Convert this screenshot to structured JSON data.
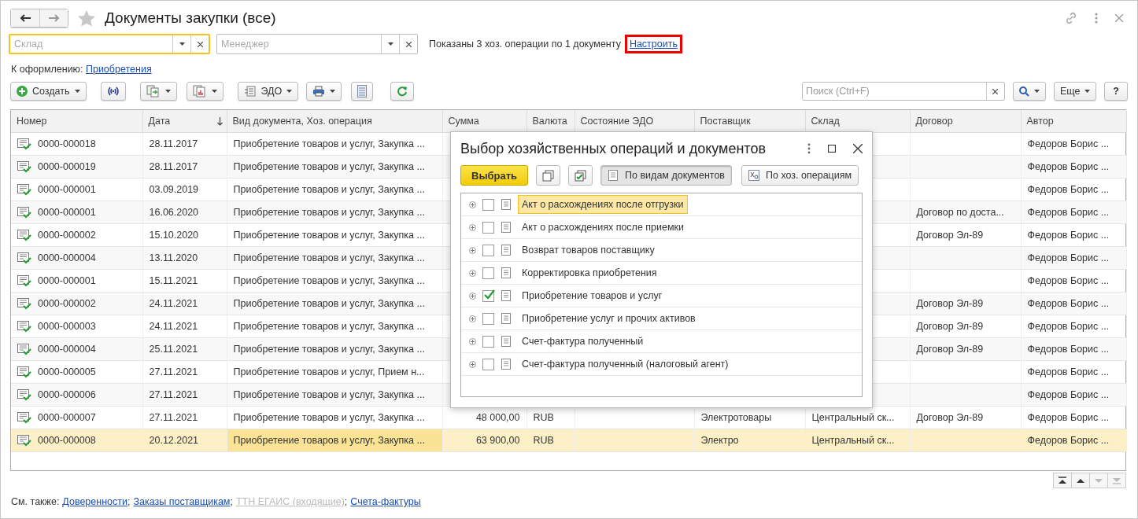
{
  "window": {
    "title": "Документы закупки (все)"
  },
  "filters": [
    {
      "placeholder": "Склад",
      "focused": true
    },
    {
      "placeholder": "Менеджер",
      "focused": false
    }
  ],
  "filter_info": "Показаны 3 хоз. операции по 1 документу",
  "configure_link": {
    "label": "Настроить",
    "highlighted": true
  },
  "to_process": {
    "label": "К оформлению:",
    "link": "Приобретения"
  },
  "toolbar": [
    {
      "label": "Создать",
      "dropdown": true
    },
    {
      "dropdown": false
    },
    {
      "dropdown": true
    },
    {
      "dropdown": true
    },
    {
      "label": "ЭДО",
      "dropdown": true
    },
    {
      "dropdown": true
    },
    {
      "dropdown": false
    },
    {
      "dropdown": false
    }
  ],
  "search": {
    "placeholder": "Поиск (Ctrl+F)"
  },
  "more_button": "Еще",
  "help_button": "?",
  "table": {
    "columns": [
      {
        "label": "Номер",
        "sorted": false
      },
      {
        "label": "Дата",
        "sorted": true
      },
      {
        "label": "Вид документа, Хоз. операция",
        "sorted": false
      },
      {
        "label": "Сумма",
        "sorted": false
      },
      {
        "label": "Валюта",
        "sorted": false
      },
      {
        "label": "Состояние ЭДО",
        "sorted": false
      },
      {
        "label": "Поставщик",
        "sorted": false
      },
      {
        "label": "Склад",
        "sorted": false
      },
      {
        "label": "Договор",
        "sorted": false
      },
      {
        "label": "Автор",
        "sorted": false
      }
    ],
    "rows": [
      {
        "number": "0000-000018",
        "date": "28.11.2017",
        "doc": "Приобретение товаров и услуг, Закупка ...",
        "author": "Федоров Борис ...",
        "selected": false
      },
      {
        "number": "0000-000019",
        "date": "28.11.2017",
        "doc": "Приобретение товаров и услуг, Закупка ...",
        "author": "Федоров Борис ...",
        "selected": false
      },
      {
        "number": "0000-000001",
        "date": "03.09.2019",
        "doc": "Приобретение товаров и услуг, Закупка ...",
        "author": "Федоров Борис ...",
        "selected": false
      },
      {
        "number": "0000-000001",
        "date": "16.06.2020",
        "doc": "Приобретение товаров и услуг, Закупка ...",
        "contract": "Договор по доста...",
        "author": "Федоров Борис ...",
        "selected": false
      },
      {
        "number": "0000-000002",
        "date": "15.10.2020",
        "doc": "Приобретение товаров и услуг, Закупка ...",
        "contract": "Договор Эл-89",
        "author": "Федоров Борис ...",
        "selected": false
      },
      {
        "number": "0000-000004",
        "date": "13.11.2020",
        "doc": "Приобретение товаров и услуг, Закупка ...",
        "author": "Федоров Борис ...",
        "selected": false
      },
      {
        "number": "0000-000001",
        "date": "15.11.2021",
        "doc": "Приобретение товаров и услуг, Закупка ...",
        "author": "Федоров Борис ...",
        "selected": false
      },
      {
        "number": "0000-000002",
        "date": "24.11.2021",
        "doc": "Приобретение товаров и услуг, Закупка ...",
        "contract": "Договор Эл-89",
        "author": "Федоров Борис ...",
        "selected": false
      },
      {
        "number": "0000-000003",
        "date": "24.11.2021",
        "doc": "Приобретение товаров и услуг, Закупка ...",
        "contract": "Договор Эл-89",
        "author": "Федоров Борис ...",
        "selected": false
      },
      {
        "number": "0000-000004",
        "date": "25.11.2021",
        "doc": "Приобретение товаров и услуг, Закупка ...",
        "contract": "Договор Эл-89",
        "author": "Федоров Борис ...",
        "selected": false
      },
      {
        "number": "0000-000005",
        "date": "27.11.2021",
        "doc": "Приобретение товаров и услуг, Прием н...",
        "author": "Федоров Борис ...",
        "selected": false
      },
      {
        "number": "0000-000006",
        "date": "27.11.2021",
        "doc": "Приобретение товаров и услуг, Закупка ...",
        "author": "Федоров Борис ...",
        "selected": false
      },
      {
        "number": "0000-000007",
        "date": "27.11.2021",
        "doc": "Приобретение товаров и услуг, Закупка ...",
        "sum": "48 000,00",
        "currency": "RUB",
        "supplier": "Электротовары",
        "warehouse": "Центральный ск...",
        "contract": "Договор Эл-89",
        "author": "Федоров Борис ...",
        "selected": false
      },
      {
        "number": "0000-000008",
        "date": "20.12.2021",
        "doc": "Приобретение товаров и услуг, Закупка ...",
        "sum": "63 900,00",
        "currency": "RUB",
        "supplier": "Электро",
        "warehouse": "Центральный ск...",
        "author": "Федоров Борис ...",
        "selected": true
      }
    ]
  },
  "pager": [
    {
      "kind": "first",
      "disabled": false
    },
    {
      "kind": "up",
      "disabled": false
    },
    {
      "kind": "down",
      "disabled": true
    },
    {
      "kind": "last",
      "disabled": true
    }
  ],
  "see_also": {
    "label": "См. также:",
    "separator": ";",
    "links": [
      {
        "label": "Доверенности",
        "disabled": false
      },
      {
        "label": "Заказы поставщикам",
        "disabled": false
      },
      {
        "label": "ТТН ЕГАИС (входящие)",
        "disabled": true
      },
      {
        "label": "Счета-фактуры",
        "disabled": false
      }
    ]
  },
  "dialog": {
    "title": "Выбор хозяйственных операций и документов",
    "select_button": "Выбрать",
    "modes": [
      {
        "label": "По видам документов",
        "selected": true
      },
      {
        "label": "По хоз. операциям",
        "selected": false
      }
    ],
    "items": [
      {
        "label": "Акт о расхождениях после отгрузки",
        "checked": false,
        "selected": true
      },
      {
        "label": "Акт о расхождениях после приемки",
        "checked": false,
        "selected": false
      },
      {
        "label": "Возврат товаров поставщику",
        "checked": false,
        "selected": false
      },
      {
        "label": "Корректировка приобретения",
        "checked": false,
        "selected": false
      },
      {
        "label": "Приобретение товаров и услуг",
        "checked": true,
        "selected": false
      },
      {
        "label": "Приобретение услуг и прочих активов",
        "checked": false,
        "selected": false
      },
      {
        "label": "Счет-фактура полученный",
        "checked": false,
        "selected": false
      },
      {
        "label": "Счет-фактура полученный (налоговый агент)",
        "checked": false,
        "selected": false
      }
    ]
  }
}
